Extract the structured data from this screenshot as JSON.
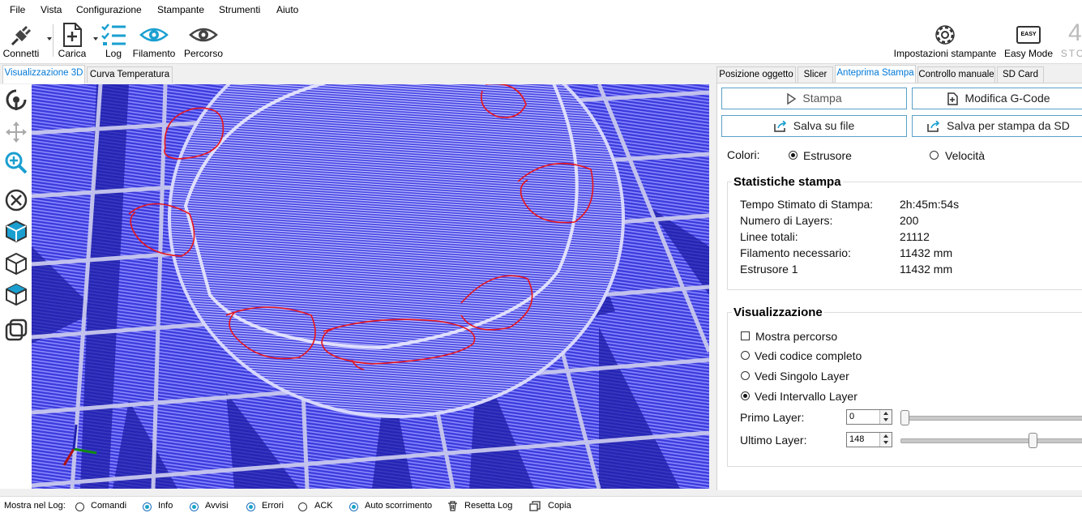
{
  "menu": [
    "File",
    "Vista",
    "Configurazione",
    "Stampante",
    "Strumenti",
    "Aiuto"
  ],
  "toolbar": {
    "connect": "Connetti",
    "load": "Carica",
    "log": "Log",
    "filament": "Filamento",
    "path": "Percorso",
    "printer_settings": "Impostazioni stampante",
    "easy_badge": "EASY",
    "easy_mode": "Easy Mode",
    "stop": "STO"
  },
  "left_tabs": [
    "Visualizzazione 3D",
    "Curva Temperatura"
  ],
  "right_tabs": [
    "Posizione oggetto",
    "Slicer",
    "Anteprima Stampa",
    "Controllo manuale",
    "SD Card"
  ],
  "preview": {
    "print_button": "Stampa",
    "edit_gcode_button": "Modifica G-Code",
    "save_file_button": "Salva su file",
    "save_sd_button": "Salva per stampa da SD",
    "colors_label": "Colori:",
    "color_extruder": "Estrusore",
    "color_speed": "Velocità",
    "stats_title": "Statistiche stampa",
    "stats": [
      {
        "label": "Tempo Stimato di Stampa:",
        "value": "2h:45m:54s"
      },
      {
        "label": "Numero di Layers:",
        "value": "200"
      },
      {
        "label": "Linee totali:",
        "value": "21112"
      },
      {
        "label": "Filamento necessario:",
        "value": "11432 mm"
      },
      {
        "label": "Estrusore 1",
        "value": "11432 mm"
      }
    ],
    "vis_title": "Visualizzazione",
    "show_path": "Mostra percorso",
    "view_full": "Vedi codice completo",
    "view_single": "Vedi Singolo Layer",
    "view_range": "Vedi Intervallo Layer",
    "first_layer_label": "Primo Layer:",
    "first_layer_value": "0",
    "last_layer_label": "Ultimo Layer:",
    "last_layer_value": "148",
    "first_layer_fraction": 0.0,
    "last_layer_fraction": 0.74
  },
  "logbar": {
    "label": "Mostra nel Log:",
    "commands": "Comandi",
    "info": "Info",
    "warnings": "Avvisi",
    "errors": "Errori",
    "ack": "ACK",
    "autoscroll": "Auto scorrimento",
    "reset": "Resetta Log",
    "copy": "Copia"
  },
  "colors": {
    "accent": "#0078d7",
    "viewport_blue": "#3f3fe0",
    "annotation_red": "#e8141c"
  }
}
